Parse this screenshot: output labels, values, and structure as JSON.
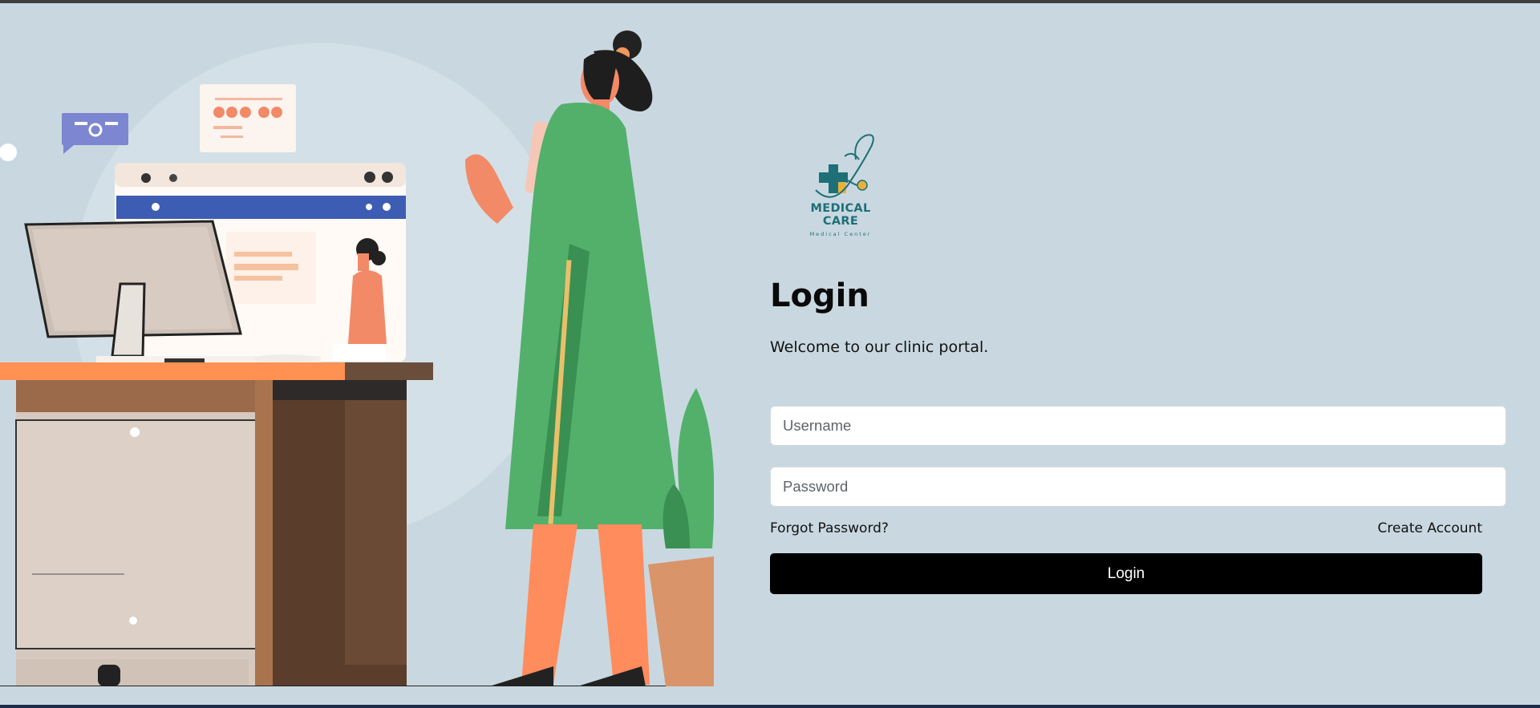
{
  "brand": {
    "name": "MEDICAL CARE",
    "subtitle": "Medical Center",
    "logo_icon": "medical-cross-stethoscope-icon",
    "colors": {
      "teal": "#1e6f77",
      "gold": "#e8b23a"
    }
  },
  "illustration": {
    "icon": "clinic-receptionist-illustration"
  },
  "form": {
    "title": "Login",
    "welcome": "Welcome to our clinic portal.",
    "username_placeholder": "Username",
    "password_placeholder": "Password",
    "forgot_label": "Forgot Password?",
    "create_label": "Create Account",
    "submit_label": "Login"
  },
  "colors": {
    "background": "#c9d8e0",
    "button": "#000000",
    "button_text": "#ffffff"
  }
}
